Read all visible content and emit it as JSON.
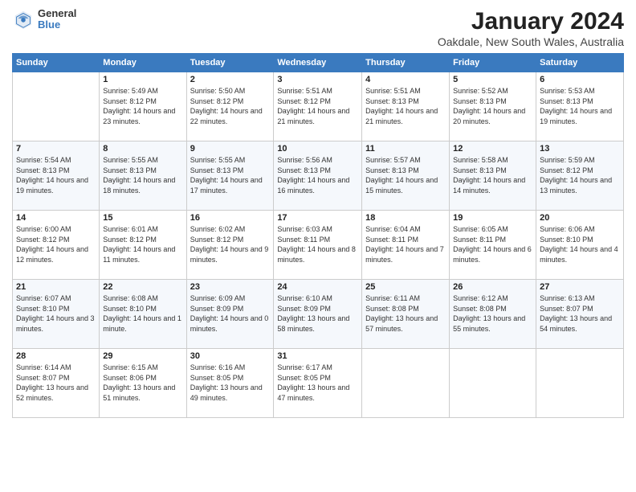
{
  "logo": {
    "general": "General",
    "blue": "Blue"
  },
  "title": "January 2024",
  "subtitle": "Oakdale, New South Wales, Australia",
  "days_header": [
    "Sunday",
    "Monday",
    "Tuesday",
    "Wednesday",
    "Thursday",
    "Friday",
    "Saturday"
  ],
  "weeks": [
    [
      {
        "day": "",
        "sunrise": "",
        "sunset": "",
        "daylight": ""
      },
      {
        "day": "1",
        "sunrise": "Sunrise: 5:49 AM",
        "sunset": "Sunset: 8:12 PM",
        "daylight": "Daylight: 14 hours and 23 minutes."
      },
      {
        "day": "2",
        "sunrise": "Sunrise: 5:50 AM",
        "sunset": "Sunset: 8:12 PM",
        "daylight": "Daylight: 14 hours and 22 minutes."
      },
      {
        "day": "3",
        "sunrise": "Sunrise: 5:51 AM",
        "sunset": "Sunset: 8:12 PM",
        "daylight": "Daylight: 14 hours and 21 minutes."
      },
      {
        "day": "4",
        "sunrise": "Sunrise: 5:51 AM",
        "sunset": "Sunset: 8:13 PM",
        "daylight": "Daylight: 14 hours and 21 minutes."
      },
      {
        "day": "5",
        "sunrise": "Sunrise: 5:52 AM",
        "sunset": "Sunset: 8:13 PM",
        "daylight": "Daylight: 14 hours and 20 minutes."
      },
      {
        "day": "6",
        "sunrise": "Sunrise: 5:53 AM",
        "sunset": "Sunset: 8:13 PM",
        "daylight": "Daylight: 14 hours and 19 minutes."
      }
    ],
    [
      {
        "day": "7",
        "sunrise": "Sunrise: 5:54 AM",
        "sunset": "Sunset: 8:13 PM",
        "daylight": "Daylight: 14 hours and 19 minutes."
      },
      {
        "day": "8",
        "sunrise": "Sunrise: 5:55 AM",
        "sunset": "Sunset: 8:13 PM",
        "daylight": "Daylight: 14 hours and 18 minutes."
      },
      {
        "day": "9",
        "sunrise": "Sunrise: 5:55 AM",
        "sunset": "Sunset: 8:13 PM",
        "daylight": "Daylight: 14 hours and 17 minutes."
      },
      {
        "day": "10",
        "sunrise": "Sunrise: 5:56 AM",
        "sunset": "Sunset: 8:13 PM",
        "daylight": "Daylight: 14 hours and 16 minutes."
      },
      {
        "day": "11",
        "sunrise": "Sunrise: 5:57 AM",
        "sunset": "Sunset: 8:13 PM",
        "daylight": "Daylight: 14 hours and 15 minutes."
      },
      {
        "day": "12",
        "sunrise": "Sunrise: 5:58 AM",
        "sunset": "Sunset: 8:13 PM",
        "daylight": "Daylight: 14 hours and 14 minutes."
      },
      {
        "day": "13",
        "sunrise": "Sunrise: 5:59 AM",
        "sunset": "Sunset: 8:12 PM",
        "daylight": "Daylight: 14 hours and 13 minutes."
      }
    ],
    [
      {
        "day": "14",
        "sunrise": "Sunrise: 6:00 AM",
        "sunset": "Sunset: 8:12 PM",
        "daylight": "Daylight: 14 hours and 12 minutes."
      },
      {
        "day": "15",
        "sunrise": "Sunrise: 6:01 AM",
        "sunset": "Sunset: 8:12 PM",
        "daylight": "Daylight: 14 hours and 11 minutes."
      },
      {
        "day": "16",
        "sunrise": "Sunrise: 6:02 AM",
        "sunset": "Sunset: 8:12 PM",
        "daylight": "Daylight: 14 hours and 9 minutes."
      },
      {
        "day": "17",
        "sunrise": "Sunrise: 6:03 AM",
        "sunset": "Sunset: 8:11 PM",
        "daylight": "Daylight: 14 hours and 8 minutes."
      },
      {
        "day": "18",
        "sunrise": "Sunrise: 6:04 AM",
        "sunset": "Sunset: 8:11 PM",
        "daylight": "Daylight: 14 hours and 7 minutes."
      },
      {
        "day": "19",
        "sunrise": "Sunrise: 6:05 AM",
        "sunset": "Sunset: 8:11 PM",
        "daylight": "Daylight: 14 hours and 6 minutes."
      },
      {
        "day": "20",
        "sunrise": "Sunrise: 6:06 AM",
        "sunset": "Sunset: 8:10 PM",
        "daylight": "Daylight: 14 hours and 4 minutes."
      }
    ],
    [
      {
        "day": "21",
        "sunrise": "Sunrise: 6:07 AM",
        "sunset": "Sunset: 8:10 PM",
        "daylight": "Daylight: 14 hours and 3 minutes."
      },
      {
        "day": "22",
        "sunrise": "Sunrise: 6:08 AM",
        "sunset": "Sunset: 8:10 PM",
        "daylight": "Daylight: 14 hours and 1 minute."
      },
      {
        "day": "23",
        "sunrise": "Sunrise: 6:09 AM",
        "sunset": "Sunset: 8:09 PM",
        "daylight": "Daylight: 14 hours and 0 minutes."
      },
      {
        "day": "24",
        "sunrise": "Sunrise: 6:10 AM",
        "sunset": "Sunset: 8:09 PM",
        "daylight": "Daylight: 13 hours and 58 minutes."
      },
      {
        "day": "25",
        "sunrise": "Sunrise: 6:11 AM",
        "sunset": "Sunset: 8:08 PM",
        "daylight": "Daylight: 13 hours and 57 minutes."
      },
      {
        "day": "26",
        "sunrise": "Sunrise: 6:12 AM",
        "sunset": "Sunset: 8:08 PM",
        "daylight": "Daylight: 13 hours and 55 minutes."
      },
      {
        "day": "27",
        "sunrise": "Sunrise: 6:13 AM",
        "sunset": "Sunset: 8:07 PM",
        "daylight": "Daylight: 13 hours and 54 minutes."
      }
    ],
    [
      {
        "day": "28",
        "sunrise": "Sunrise: 6:14 AM",
        "sunset": "Sunset: 8:07 PM",
        "daylight": "Daylight: 13 hours and 52 minutes."
      },
      {
        "day": "29",
        "sunrise": "Sunrise: 6:15 AM",
        "sunset": "Sunset: 8:06 PM",
        "daylight": "Daylight: 13 hours and 51 minutes."
      },
      {
        "day": "30",
        "sunrise": "Sunrise: 6:16 AM",
        "sunset": "Sunset: 8:05 PM",
        "daylight": "Daylight: 13 hours and 49 minutes."
      },
      {
        "day": "31",
        "sunrise": "Sunrise: 6:17 AM",
        "sunset": "Sunset: 8:05 PM",
        "daylight": "Daylight: 13 hours and 47 minutes."
      },
      {
        "day": "",
        "sunrise": "",
        "sunset": "",
        "daylight": ""
      },
      {
        "day": "",
        "sunrise": "",
        "sunset": "",
        "daylight": ""
      },
      {
        "day": "",
        "sunrise": "",
        "sunset": "",
        "daylight": ""
      }
    ]
  ]
}
